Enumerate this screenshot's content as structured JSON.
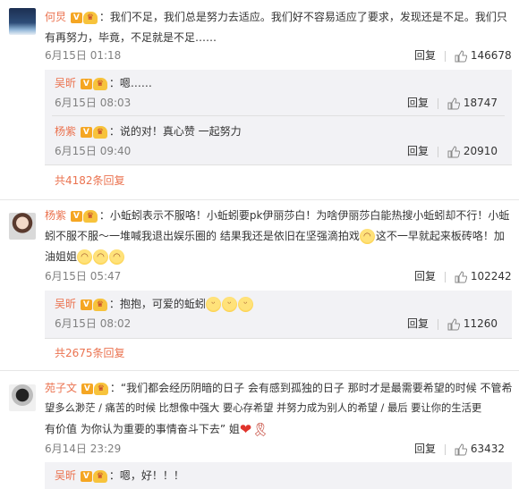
{
  "comments": [
    {
      "user": "何炅",
      "text_lines": [
        "我们不足，我们总是努力去适应。我们好不容易适应了要求，发现还是不足。我们只",
        "有再努力，毕竟，不足就是不足……"
      ],
      "time": "6月15日 01:18",
      "reply_label": "回复",
      "likes": "146678",
      "replies": [
        {
          "user": "吴昕",
          "text": "嗯……",
          "time": "6月15日 08:03",
          "reply_label": "回复",
          "likes": "18747"
        },
        {
          "user": "杨紫",
          "text": "说的对！真心赞 一起努力",
          "time": "6月15日 09:40",
          "reply_label": "回复",
          "likes": "20910"
        }
      ],
      "more_replies": "共4182条回复"
    },
    {
      "user": "杨紫",
      "text_lines": [
        "小蚯蚓表示不服咯！小蚯蚓要pk伊丽莎白！为啥伊丽莎白能热搜小蚯蚓却不行！小蚯",
        "蚓不服不服～一堆喊我退出娱乐圈的 结果我还是依旧在坚强滴拍戏",
        "这不一早就起来板砖咯！加",
        "油姐姐"
      ],
      "time": "6月15日 05:47",
      "reply_label": "回复",
      "likes": "102242",
      "replies": [
        {
          "user": "吴昕",
          "text": "抱抱，可爱的蚯蚓",
          "time": "6月15日 08:02",
          "reply_label": "回复",
          "likes": "11260"
        }
      ],
      "more_replies": "共2675条回复"
    },
    {
      "user": "苑子文",
      "text_lines": [
        "“我们都会经历阴暗的日子 会有感到孤独的日子 那时才是最需要希望的时候 不管希",
        "望多么渺茫 / 痛苦的时候 比想像中强大 要心存希望 并努力成为别人的希望 / 最后 要让你的生活更",
        "有价值 为你认为重要的事情奋斗下去” 姐"
      ],
      "time": "6月14日 23:29",
      "reply_label": "回复",
      "likes": "63432",
      "replies": [
        {
          "user": "吴昕",
          "text": "嗯，好！！！"
        }
      ]
    }
  ],
  "badges": {
    "verified": "V",
    "crown": "♛"
  },
  "icons": {
    "like": "thumbs-up-icon"
  }
}
